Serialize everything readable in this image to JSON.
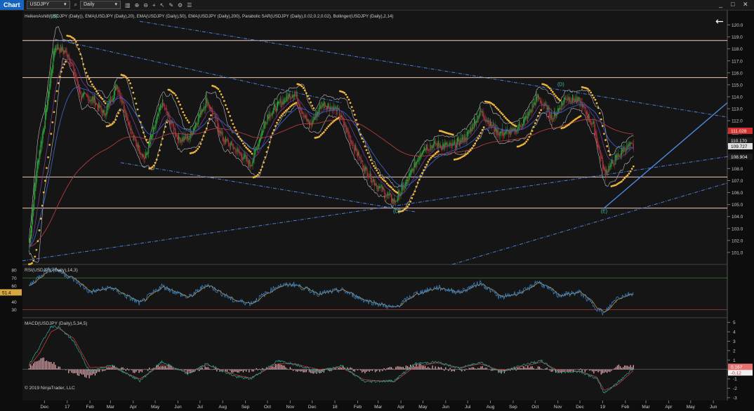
{
  "toolbar": {
    "app_label": "Chart",
    "instrument": "USDJPY",
    "timeframe": "Daily",
    "window_controls": [
      "_",
      "□",
      "✕"
    ]
  },
  "back_icon": "←",
  "price_panel": {
    "indicator_header": "HeikenAshi8(USDJPY (Daily)), EMA(USDJPY (Daily),20), EMA(USDJPY (Daily),50), EMA(USDJPY (Daily),200), Parabolic SAR(USDJPY (Daily),0.02,0.2,0.02), Bollinger(USDJPY (Daily),2,14)",
    "wave_labels": [
      {
        "text": "(B)",
        "date": "2016-12-14",
        "price": 120.6
      },
      {
        "text": "(C)",
        "date": "2018-03-26",
        "price": 104.3
      },
      {
        "text": "(D)",
        "date": "2018-11-05",
        "price": 114.9
      },
      {
        "text": "(E)",
        "date": "2019-01-03",
        "price": 104.3
      }
    ],
    "price_tags": [
      {
        "text": "111.028",
        "bg": "#d32f2f",
        "fg": "#ffffff"
      },
      {
        "text": "110.170",
        "bg": "#1b1b1b",
        "fg": "#ffffff"
      },
      {
        "text": "109.727",
        "bg": "#e0e0e0",
        "fg": "#000000"
      },
      {
        "text": "108.904",
        "bg": "#1b1b1b",
        "fg": "#ffffff"
      }
    ]
  },
  "rsi_panel": {
    "header": "RSI(USDJPY (Daily),14,3)",
    "value_tag": "51.4"
  },
  "macd_panel": {
    "header": "MACD(USDJPY (Daily),5,34,5)",
    "value_tag": "0.167",
    "value_tag2": "-0.12",
    "copyright": "© 2019 NinjaTrader, LLC"
  },
  "chart_data": [
    {
      "type": "line",
      "subtype": "heikin-ashi candlestick with overlays",
      "title": "",
      "xlabel": "",
      "ylabel": "",
      "x_tick_labels": [
        "Dec",
        "17",
        "Feb",
        "Mar",
        "Apr",
        "May",
        "Jun",
        "Jul",
        "Aug",
        "Sep",
        "Oct",
        "Nov",
        "Dec",
        "18",
        "Feb",
        "Mar",
        "Apr",
        "May",
        "Jun",
        "Jul",
        "Aug",
        "Sep",
        "Oct",
        "Nov",
        "Dec",
        "19",
        "Feb",
        "Mar",
        "Apr",
        "May",
        "Jun"
      ],
      "x_tick_dates": [
        "2016-12-01",
        "2017-01-01",
        "2017-02-01",
        "2017-03-01",
        "2017-04-01",
        "2017-05-01",
        "2017-06-01",
        "2017-07-01",
        "2017-08-01",
        "2017-09-01",
        "2017-10-01",
        "2017-11-01",
        "2017-12-01",
        "2018-01-01",
        "2018-02-01",
        "2018-03-01",
        "2018-04-01",
        "2018-05-01",
        "2018-06-01",
        "2018-07-01",
        "2018-08-01",
        "2018-09-01",
        "2018-10-01",
        "2018-11-01",
        "2018-12-01",
        "2019-01-01",
        "2019-02-01",
        "2019-03-01",
        "2019-04-01",
        "2019-05-01",
        "2019-06-01"
      ],
      "xlim": [
        "2016-11-01",
        "2019-06-20"
      ],
      "y_tick_labels": [
        "101.0",
        "102.0",
        "103.0",
        "104.0",
        "105.0",
        "106.0",
        "107.0",
        "108.0",
        "109.0",
        "110.0",
        "111.0",
        "112.0",
        "113.0",
        "114.0",
        "115.0",
        "116.0",
        "117.0",
        "118.0",
        "119.0",
        "120.0"
      ],
      "ylim": [
        100.0,
        120.5
      ],
      "grid": false,
      "horizontal_levels": [
        118.7,
        115.6,
        107.3,
        104.7
      ],
      "close_series": {
        "name": "",
        "x": [
          "2016-11-10",
          "2016-11-20",
          "2016-12-01",
          "2016-12-15",
          "2017-01-03",
          "2017-01-20",
          "2017-02-05",
          "2017-02-20",
          "2017-03-10",
          "2017-04-01",
          "2017-04-17",
          "2017-05-10",
          "2017-06-01",
          "2017-06-15",
          "2017-07-10",
          "2017-08-01",
          "2017-08-20",
          "2017-09-08",
          "2017-10-01",
          "2017-10-20",
          "2017-11-06",
          "2017-11-27",
          "2017-12-15",
          "2018-01-05",
          "2018-01-20",
          "2018-02-10",
          "2018-03-01",
          "2018-03-23",
          "2018-04-10",
          "2018-05-01",
          "2018-05-20",
          "2018-06-10",
          "2018-07-01",
          "2018-07-18",
          "2018-08-10",
          "2018-09-01",
          "2018-09-20",
          "2018-10-04",
          "2018-10-25",
          "2018-11-12",
          "2018-12-01",
          "2018-12-20",
          "2019-01-03",
          "2019-01-15",
          "2019-02-01",
          "2019-02-12"
        ],
        "y": [
          101.5,
          108.0,
          112.0,
          118.3,
          117.5,
          114.0,
          113.8,
          112.5,
          115.0,
          110.5,
          108.8,
          113.5,
          110.5,
          110.5,
          113.8,
          110.5,
          109.5,
          108.3,
          112.5,
          113.5,
          114.4,
          111.5,
          113.5,
          112.8,
          110.7,
          108.0,
          106.5,
          105.2,
          107.0,
          109.8,
          110.0,
          109.8,
          110.8,
          112.8,
          111.0,
          111.0,
          112.3,
          114.0,
          112.2,
          114.0,
          113.5,
          111.5,
          107.6,
          108.5,
          109.8,
          109.8
        ]
      },
      "parabolic_sar_note": "dotted stop-and-reverse points",
      "trendlines_note": "dash-dot channel lines"
    },
    {
      "type": "line",
      "name": "RSI",
      "title": "",
      "y_tick_labels": [
        "30",
        "40",
        "50",
        "60",
        "70",
        "80"
      ],
      "ylim": [
        20,
        87
      ],
      "levels": [
        70,
        30
      ],
      "x": [
        "2016-11-10",
        "2016-12-01",
        "2016-12-15",
        "2017-01-10",
        "2017-02-01",
        "2017-03-01",
        "2017-04-10",
        "2017-05-10",
        "2017-06-15",
        "2017-07-10",
        "2017-08-15",
        "2017-09-08",
        "2017-10-15",
        "2017-11-06",
        "2017-12-10",
        "2018-01-10",
        "2018-02-10",
        "2018-03-23",
        "2018-04-20",
        "2018-05-20",
        "2018-06-20",
        "2018-07-18",
        "2018-08-15",
        "2018-09-20",
        "2018-10-04",
        "2018-11-01",
        "2018-12-01",
        "2018-12-24",
        "2019-01-03",
        "2019-01-20",
        "2019-02-12"
      ],
      "y": [
        60,
        78,
        82,
        68,
        52,
        58,
        38,
        60,
        45,
        62,
        42,
        38,
        60,
        62,
        50,
        55,
        42,
        32,
        50,
        58,
        52,
        64,
        45,
        55,
        66,
        48,
        52,
        32,
        25,
        45,
        51.4
      ]
    },
    {
      "type": "bar",
      "name": "MACD",
      "title": "",
      "y_tick_labels": [
        "-3",
        "-2",
        "-1",
        "0",
        "1",
        "2",
        "3",
        "4",
        "5"
      ],
      "ylim": [
        -3.3,
        5.5
      ],
      "x": [
        "2016-11-10",
        "2016-11-25",
        "2016-12-10",
        "2016-12-20",
        "2017-01-10",
        "2017-02-01",
        "2017-03-01",
        "2017-04-10",
        "2017-05-10",
        "2017-06-15",
        "2017-07-10",
        "2017-08-20",
        "2017-09-08",
        "2017-10-15",
        "2017-11-06",
        "2017-12-10",
        "2018-01-10",
        "2018-02-10",
        "2018-03-23",
        "2018-04-20",
        "2018-05-20",
        "2018-06-20",
        "2018-07-18",
        "2018-08-15",
        "2018-09-20",
        "2018-10-10",
        "2018-11-01",
        "2018-12-01",
        "2018-12-24",
        "2019-01-03",
        "2019-01-20",
        "2019-02-12"
      ],
      "macd": [
        0.5,
        2.5,
        4.6,
        4.5,
        3.0,
        -0.3,
        0.5,
        -1.2,
        0.8,
        -0.5,
        0.6,
        -0.8,
        -1.0,
        0.9,
        0.6,
        -0.2,
        0.4,
        -1.3,
        -1.2,
        0.6,
        0.8,
        0.1,
        0.8,
        -0.3,
        0.6,
        0.9,
        -0.3,
        -0.2,
        -1.0,
        -2.5,
        -1.5,
        0.167
      ],
      "signal": [
        0.3,
        1.8,
        4.0,
        4.4,
        3.3,
        0.2,
        0.3,
        -1.0,
        0.5,
        -0.3,
        0.5,
        -0.6,
        -0.9,
        0.6,
        0.6,
        0.0,
        0.2,
        -1.1,
        -1.3,
        0.3,
        0.7,
        0.2,
        0.6,
        -0.1,
        0.4,
        0.8,
        -0.1,
        -0.2,
        -0.8,
        -2.2,
        -1.7,
        -0.12
      ]
    }
  ]
}
